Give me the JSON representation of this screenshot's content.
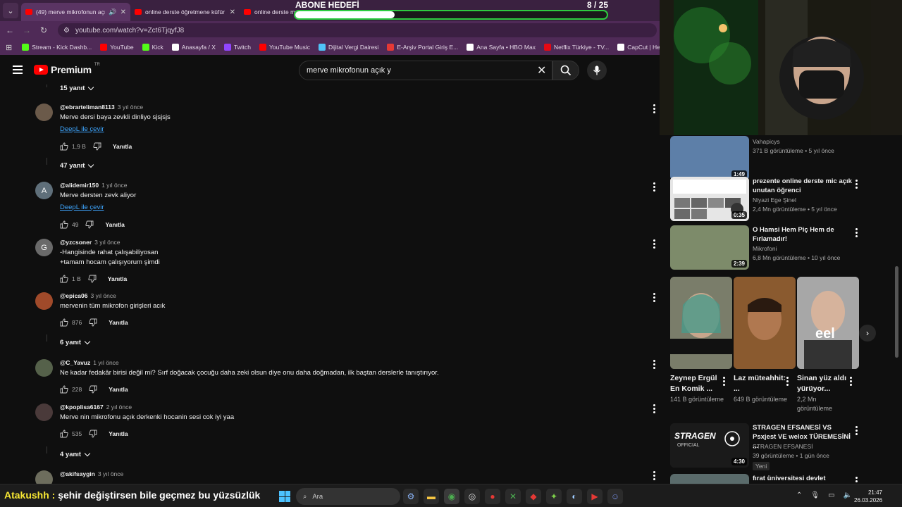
{
  "browser": {
    "tabs": [
      {
        "title": "(49) merve mikrofonun açık",
        "active": true
      },
      {
        "title": "online derste öğretmene küfür",
        "active": false
      },
      {
        "title": "online derste m",
        "active": false
      }
    ],
    "url": "youtube.com/watch?v=Zct6TjqyfJ8",
    "bookmarks": [
      {
        "label": "Stream - Kick Dashb...",
        "color": "#53fc18"
      },
      {
        "label": "YouTube",
        "color": "#ff0000"
      },
      {
        "label": "Kick",
        "color": "#53fc18"
      },
      {
        "label": "Anasayfa / X",
        "color": "#ffffff"
      },
      {
        "label": "Twitch",
        "color": "#9146ff"
      },
      {
        "label": "YouTube Music",
        "color": "#ff0000"
      },
      {
        "label": "Dijital Vergi Dairesi",
        "color": "#4fc3f7"
      },
      {
        "label": "E-Arşiv Portal Giriş E...",
        "color": "#e53935"
      },
      {
        "label": "Ana Sayfa • HBO Max",
        "color": "#ffffff"
      },
      {
        "label": "Netflix Türkiye - TV...",
        "color": "#e50914"
      },
      {
        "label": "CapCut | Hepsi bir a...",
        "color": "#ffffff"
      }
    ]
  },
  "overlay": {
    "goal_title": "ABONE HEDEFİ",
    "goal_count": "8 / 25",
    "goal_progress": 0.32
  },
  "youtube": {
    "logo_text": "Premium",
    "logo_region": "TR",
    "search_value": "merve mikrofonun açık y"
  },
  "comments": {
    "replies": [
      {
        "label": "15 yanıt"
      },
      {
        "label": "47 yanıt"
      },
      {
        "label": "6 yanıt"
      },
      {
        "label": "4 yanıt"
      }
    ],
    "items": [
      {
        "user": "@ebrarteliman8113",
        "time": "3 yıl önce",
        "lines": [
          "Merve dersi baya zevkli dinliyo sjsjsjs"
        ],
        "translate": "DeepL ile çevir",
        "likes": "1,9 B",
        "reply": "Yanıtla",
        "avatar_color": "#6b5a4a",
        "avatar_letter": ""
      },
      {
        "user": "@alidemir150",
        "time": "1 yıl önce",
        "lines": [
          "Merve dersten zevk aliyor"
        ],
        "translate": "DeepL ile çevir",
        "likes": "49",
        "reply": "Yanıtla",
        "avatar_color": "#5f6f7a",
        "avatar_letter": "A"
      },
      {
        "user": "@yzcsoner",
        "time": "3 yıl önce",
        "lines": [
          "-Hangisinde rahat çalışabiliyosan",
          "+tamam hocam çalışıyorum şimdi"
        ],
        "translate": "",
        "likes": "1 B",
        "reply": "Yanıtla",
        "avatar_color": "#6a6a6a",
        "avatar_letter": "G"
      },
      {
        "user": "@epica06",
        "time": "3 yıl önce",
        "lines": [
          "mervenin tüm mikrofon girişleri acık"
        ],
        "translate": "",
        "likes": "876",
        "reply": "Yanıtla",
        "avatar_color": "#a04a2a",
        "avatar_letter": ""
      },
      {
        "user": "@C_Yavuz",
        "time": "1 yıl önce",
        "lines": [
          "Ne kadar fedakâr birisi değil mi? Sırf doğacak çocuğu daha zeki olsun diye onu daha doğmadan, ilk baştan derslerle tanıştırıyor."
        ],
        "translate": "",
        "likes": "228",
        "reply": "Yanıtla",
        "avatar_color": "#55614a",
        "avatar_letter": ""
      },
      {
        "user": "@kpoplisa6167",
        "time": "2 yıl önce",
        "lines": [
          "Merve nin mikrofonu açık derkenki hocanin sesi cok iyi yaa"
        ],
        "translate": "",
        "likes": "535",
        "reply": "Yanıtla",
        "avatar_color": "#4a3a3a",
        "avatar_letter": ""
      },
      {
        "user": "@akifsaygin",
        "time": "3 yıl önce",
        "lines": [
          ""
        ],
        "translate": "",
        "likes": "",
        "reply": "",
        "avatar_color": "#6d6d5d",
        "avatar_letter": ""
      }
    ]
  },
  "sidebar": {
    "videos": [
      {
        "title": "",
        "channel": "Vahapicys",
        "meta": "371 B görüntüleme • 5 yıl önce",
        "duration": "1:49",
        "thumb": "#5d7fa8"
      },
      {
        "title": "prezente online derste mic açık unutan öğrenci",
        "channel": "Niyazi Ege Şinel",
        "meta": "2,4 Mn görüntüleme • 5 yıl önce",
        "duration": "0:35",
        "thumb": "#d8d8d8"
      },
      {
        "title": "O Hamsi Hem Piç Hem de Fırlamadır!",
        "channel": "Mikrofoni",
        "meta": "6,8 Mn görüntüleme • 10 yıl önce",
        "duration": "2:39",
        "thumb": "#7d8b6a"
      },
      {
        "title": "STRAGEN EFSANESİ VS Psxjest VE welox TÜREMESİNİ ...",
        "channel": "STRAGEN EFSANESİ",
        "meta": "39 görüntüleme • 1 gün önce",
        "duration": "4:30",
        "thumb": "#222222",
        "badge": "Yeni"
      },
      {
        "title": "fırat üniversitesi devlet",
        "channel": "",
        "meta": "",
        "duration": "",
        "thumb": "#5a6b6b"
      }
    ],
    "shorts": [
      {
        "title": "Zeynep Ergül En Komik ...",
        "views": "141 B görüntüleme",
        "thumb": "#6a6f5f"
      },
      {
        "title": "Laz müteahhit: ...",
        "views": "649 B görüntüleme",
        "thumb": "#8a5a2f"
      },
      {
        "title": "Sinan yüz aldı yürüyor...",
        "views": "2,2 Mn görüntüleme",
        "thumb": "#b5b5b5",
        "overlay": "eel"
      }
    ]
  },
  "taskbar": {
    "ticker_nick": "Atakushh :",
    "ticker_text": " şehir değiştirsen bile geçmez bu yüzsüzlük",
    "search_placeholder": "Ara",
    "time": "21:47",
    "date": "26.03.2026"
  }
}
